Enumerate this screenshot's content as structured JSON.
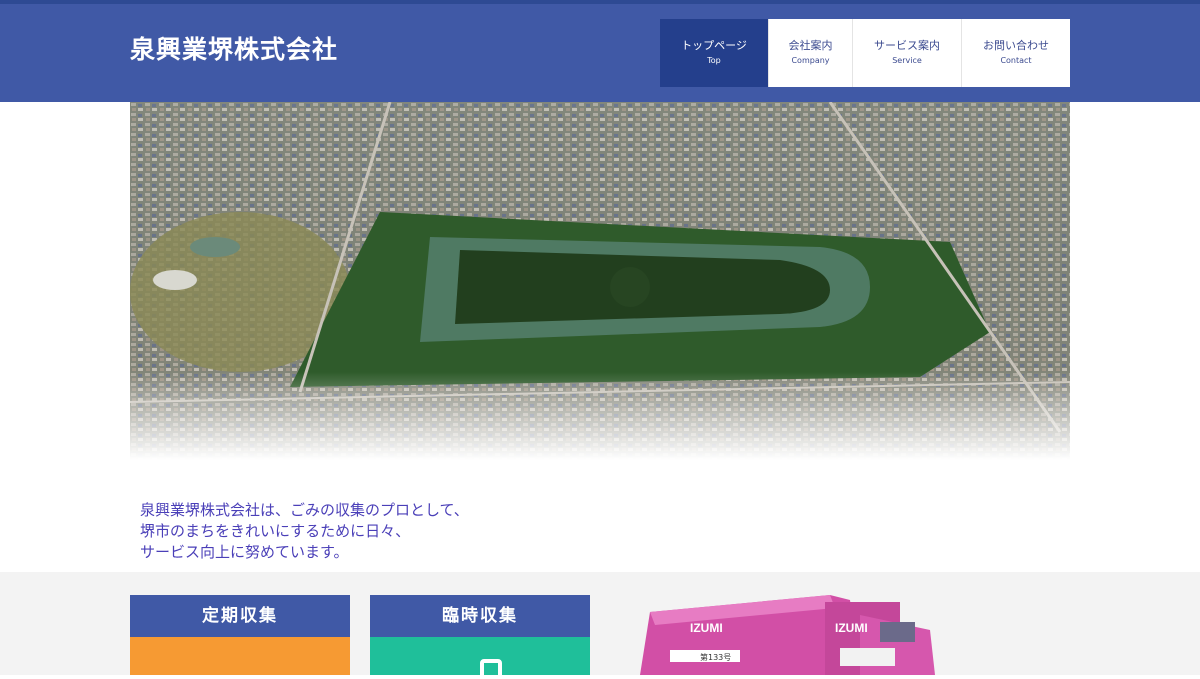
{
  "header": {
    "site_title": "泉興業堺株式会社"
  },
  "nav": [
    {
      "jp": "トップページ",
      "en": "Top",
      "active": true
    },
    {
      "jp": "会社案内",
      "en": "Company",
      "active": false
    },
    {
      "jp": "サービス案内",
      "en": "Service",
      "active": false
    },
    {
      "jp": "お問い合わせ",
      "en": "Contact",
      "active": false
    }
  ],
  "intro": {
    "line1": "泉興業堺株式会社は、ごみの収集のプロとして、",
    "line2": "堺市のまちをきれいにするために日々、",
    "line3": "サービス向上に努めています。"
  },
  "cards": [
    {
      "title": "定期収集",
      "color": "#f69a33"
    },
    {
      "title": "臨時収集",
      "color": "#1fbf9a"
    }
  ],
  "truck": {
    "brand": "IZUMI",
    "plate": "第133号"
  },
  "colors": {
    "header": "#4059a6",
    "nav_active": "#243f8c",
    "intro_text": "#4a3fb8"
  }
}
